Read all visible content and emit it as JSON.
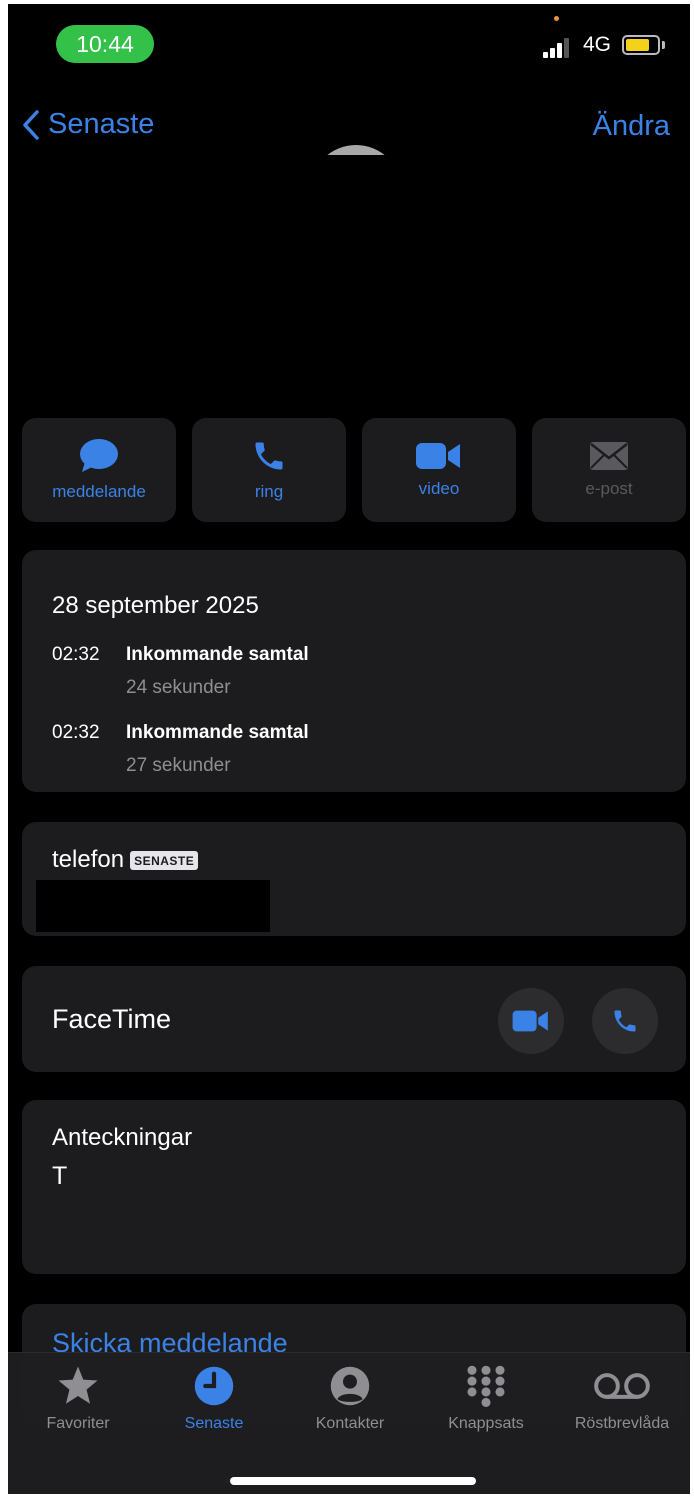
{
  "status_bar": {
    "time": "10:44",
    "network": "4G",
    "battery_level": 0.75,
    "colors": {
      "time_pill": "#33c14a",
      "battery": "#f4d21a"
    }
  },
  "nav": {
    "back_label": "Senaste",
    "edit_label": "Ändra"
  },
  "actions": [
    {
      "label": "meddelande",
      "icon": "message-bubble-icon",
      "enabled": true
    },
    {
      "label": "ring",
      "icon": "phone-icon",
      "enabled": true
    },
    {
      "label": "video",
      "icon": "video-camera-icon",
      "enabled": true
    },
    {
      "label": "e-post",
      "icon": "envelope-icon",
      "enabled": false
    }
  ],
  "call_history": {
    "date": "28 september 2025",
    "calls": [
      {
        "time": "02:32",
        "type": "Inkommande samtal",
        "duration": "24 sekunder"
      },
      {
        "time": "02:32",
        "type": "Inkommande samtal",
        "duration": "27 sekunder"
      }
    ]
  },
  "phone": {
    "label": "telefon",
    "badge": "SENASTE"
  },
  "facetime": {
    "label": "FaceTime"
  },
  "notes": {
    "label": "Anteckningar",
    "value": "T"
  },
  "send_message": {
    "label": "Skicka meddelande"
  },
  "tab_bar": {
    "active": "Senaste",
    "tabs": [
      {
        "label": "Favoriter",
        "icon": "star-icon"
      },
      {
        "label": "Senaste",
        "icon": "clock-icon"
      },
      {
        "label": "Kontakter",
        "icon": "person-circle-icon"
      },
      {
        "label": "Knappsats",
        "icon": "keypad-icon"
      },
      {
        "label": "Röstbrevlåda",
        "icon": "voicemail-icon"
      }
    ]
  },
  "accent_color": "#3b82e6"
}
